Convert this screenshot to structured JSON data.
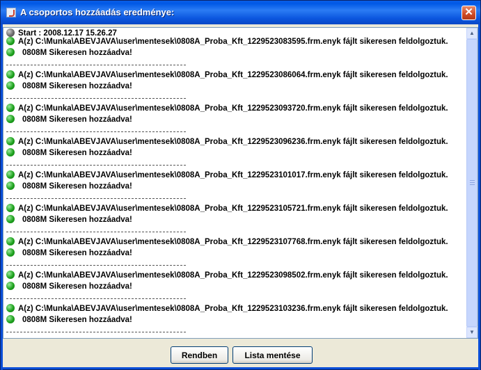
{
  "window": {
    "title": "A csoportos hozzáadás eredménye:",
    "close_glyph": "✕"
  },
  "log": {
    "start": "Start : 2008.12.17 15.26.27",
    "separator": "----------------------------------------------------",
    "entries": [
      {
        "file": "A(z) C:\\Munka\\ABEVJAVA\\user\\mentesek\\0808A_Proba_Kft_1229523083595.frm.enyk fájlt sikeresen feldolgoztuk.",
        "result": "0808M Sikeresen hozzáadva!"
      },
      {
        "file": "A(z) C:\\Munka\\ABEVJAVA\\user\\mentesek\\0808A_Proba_Kft_1229523086064.frm.enyk fájlt sikeresen feldolgoztuk.",
        "result": "0808M Sikeresen hozzáadva!"
      },
      {
        "file": "A(z) C:\\Munka\\ABEVJAVA\\user\\mentesek\\0808A_Proba_Kft_1229523093720.frm.enyk fájlt sikeresen feldolgoztuk.",
        "result": "0808M Sikeresen hozzáadva!"
      },
      {
        "file": "A(z) C:\\Munka\\ABEVJAVA\\user\\mentesek\\0808A_Proba_Kft_1229523096236.frm.enyk fájlt sikeresen feldolgoztuk.",
        "result": "0808M Sikeresen hozzáadva!"
      },
      {
        "file": "A(z) C:\\Munka\\ABEVJAVA\\user\\mentesek\\0808A_Proba_Kft_1229523101017.frm.enyk fájlt sikeresen feldolgoztuk.",
        "result": "0808M Sikeresen hozzáadva!"
      },
      {
        "file": "A(z) C:\\Munka\\ABEVJAVA\\user\\mentesek\\0808A_Proba_Kft_1229523105721.frm.enyk fájlt sikeresen feldolgoztuk.",
        "result": "0808M Sikeresen hozzáadva!"
      },
      {
        "file": "A(z) C:\\Munka\\ABEVJAVA\\user\\mentesek\\0808A_Proba_Kft_1229523107768.frm.enyk fájlt sikeresen feldolgoztuk.",
        "result": "0808M Sikeresen hozzáadva!"
      },
      {
        "file": "A(z) C:\\Munka\\ABEVJAVA\\user\\mentesek\\0808A_Proba_Kft_1229523098502.frm.enyk fájlt sikeresen feldolgoztuk.",
        "result": "0808M Sikeresen hozzáadva!"
      },
      {
        "file": "A(z) C:\\Munka\\ABEVJAVA\\user\\mentesek\\0808A_Proba_Kft_1229523103236.frm.enyk fájlt sikeresen feldolgoztuk.",
        "result": "0808M Sikeresen hozzáadva!"
      }
    ]
  },
  "buttons": {
    "ok_label": "Rendben",
    "save_list_label": "Lista mentése"
  },
  "icons": {
    "start": "gray-status-dot-icon",
    "success": "green-status-dot-icon"
  },
  "colors": {
    "success": "#1fa31f",
    "start": "#6b6b6b",
    "title_bar": "#0058e6"
  }
}
